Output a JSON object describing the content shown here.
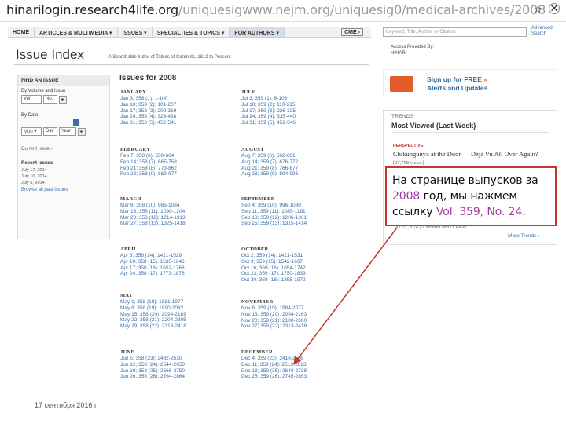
{
  "browser": {
    "url_host": "hinarilogin.research4life.org",
    "url_path": "/uniquesigwww.nejm.org/uniquesig0/medical-archives/2008",
    "star_icon": "star-icon",
    "close_icon": "close-icon"
  },
  "nav": {
    "items": [
      "HOME",
      "ARTICLES & MULTIMEDIA ▾",
      "ISSUES ▾",
      "SPECIALTIES & TOPICS ▾",
      "FOR AUTHORS ▾"
    ],
    "cme": "CME ›",
    "search_placeholder": "Keyword, Title, Author, or Citation",
    "advanced_search": "Advanced Search"
  },
  "header": {
    "title": "Issue Index",
    "subtitle": "A Searchable Index of Tables of Contents, 1812 to Present"
  },
  "sidebar": {
    "title": "FIND AN ISSUE",
    "by_volume_label": "By Volume and Issue",
    "vol_placeholder": "Vol.",
    "no_placeholder": "No.",
    "go_label": "▸",
    "by_date_label": "By Date",
    "month_value": "Mon ▾",
    "day_placeholder": "Day",
    "year_placeholder": "Year",
    "current_issue": "Current Issue ›",
    "recent_issues_label": "Recent Issues",
    "recent": [
      "July 17, 2014",
      "July 10, 2014",
      "July 3, 2014"
    ],
    "browse_all": "Browse all past issues"
  },
  "issues_heading": "Issues for 2008",
  "months_left": [
    {
      "name": "JANUARY",
      "issues": [
        "Jan 3; 358 (1): 1-100",
        "Jan 10; 358 (2): 101-207",
        "Jan 17; 358 (3): 209-319",
        "Jan 24; 358 (4): 323-438",
        "Jan 31; 358 (5): 452-541"
      ]
    },
    {
      "name": "FEBRUARY",
      "issues": [
        "Feb 7; 358 (6): 550-664",
        "Feb 14; 358 (7): 665-758",
        "Feb 21; 358 (8): 773-862",
        "Feb 28; 358 (9): 869-977"
      ]
    },
    {
      "name": "MARCH",
      "issues": [
        "Mar 6; 358 (10): 985-1084",
        "Mar 13; 358 (11): 1090-1204",
        "Mar 20; 358 (12): 1214-1313",
        "Mar 27; 358 (13): 1325-1418"
      ]
    },
    {
      "name": "APRIL",
      "issues": [
        "Apr 3; 358 (14): 1421-1529",
        "Apr 10; 358 (15): 1535-1646",
        "Apr 17; 358 (16): 1652-1768",
        "Apr 24; 358 (17): 1773-1876"
      ]
    },
    {
      "name": "MAY",
      "issues": [
        "May 1; 358 (18): 1881-1977",
        "May 8; 358 (19): 1990-2082",
        "May 15; 358 (20): 2094-2189",
        "May 22; 358 (21): 2204-2305",
        "May 29; 358 (22): 2318-2418"
      ]
    },
    {
      "name": "JUNE",
      "issues": [
        "Jun 5; 358 (23): 2432-2530",
        "Jun 12; 358 (24): 2544-2650",
        "Jun 19; 358 (25): 2666-2750",
        "Jun 26; 358 (26): 2764-2864"
      ]
    }
  ],
  "months_right": [
    {
      "name": "JULY",
      "issues": [
        "Jul 3; 359 (1): 6-106",
        "Jul 10; 359 (2): 110-215",
        "Jul 17; 359 (3): 226-325",
        "Jul 24; 359 (4): 335-440",
        "Jul 31; 359 (5): 452-546"
      ]
    },
    {
      "name": "AUGUST",
      "issues": [
        "Aug 7; 359 (6): 562-661",
        "Aug 14; 359 (7): 676-772",
        "Aug 21; 359 (8): 766-877",
        "Aug 28; 359 (9): 894-993"
      ]
    },
    {
      "name": "SEPTEMBER",
      "issues": [
        "Sep 4; 359 (10): 996-1080",
        "Sep 11; 359 (11): 1085-1191",
        "Sep 18; 359 (12): 1206-1301",
        "Sep 25; 359 (13): 1315-1414"
      ]
    },
    {
      "name": "OCTOBER",
      "issues": [
        "Oct 2; 359 (14): 1421-1531",
        "Oct 9; 359 (15): 1542-1637",
        "Oct 16; 359 (16): 1654-1742",
        "Oct 23; 359 (17): 1750-1839",
        "Oct 30; 359 (18): 1855-1972"
      ]
    },
    {
      "name": "NOVEMBER",
      "issues": [
        "Nov 6; 359 (19): 1984-2077",
        "Nov 13; 359 (20): 2094-2163",
        "Nov 20; 359 (21): 2180-2300",
        "Nov 27; 359 (22): 2313-2418"
      ]
    },
    {
      "name": "DECEMBER",
      "issues": [
        "Dec 4; 359 (23): 2416-2508",
        "Dec 11; 359 (24): 2513-2623",
        "Dec 18; 359 (25): 2640-2738",
        "Dec 25; 359 (26): 2745-2853"
      ]
    }
  ],
  "right": {
    "access_line1": "Access Provided By:",
    "access_line2": "HINARI",
    "signup_line1": "Sign up for FREE",
    "signup_arrow": "»",
    "signup_line2": "Alerts and Updates",
    "trends_label": "TRENDS",
    "trends_title": "Most Viewed (Last Week)",
    "trend_tag": "PERSPECTIVE",
    "trend_title": "Chikungunya at the Door — Déjà Vu All Over Again?",
    "trend_views": "[27,758 views]",
    "trend_meta": "Jul 10, 2014 | T. Morens and D. Fauci",
    "more_trends": "More Trends ›"
  },
  "callout": {
    "part1": "На странице выпусков за ",
    "year": "2008",
    "part2": " год, мы нажмем ссылку ",
    "link": "Vol. 359, No. 24",
    "part3": "."
  },
  "footer": {
    "date": "17 сентября 2016 г."
  },
  "colors": {
    "link": "#3a6ea5",
    "callout_border": "#c0392b",
    "highlight": "#a23aa4",
    "arrow": "#c0392b"
  }
}
